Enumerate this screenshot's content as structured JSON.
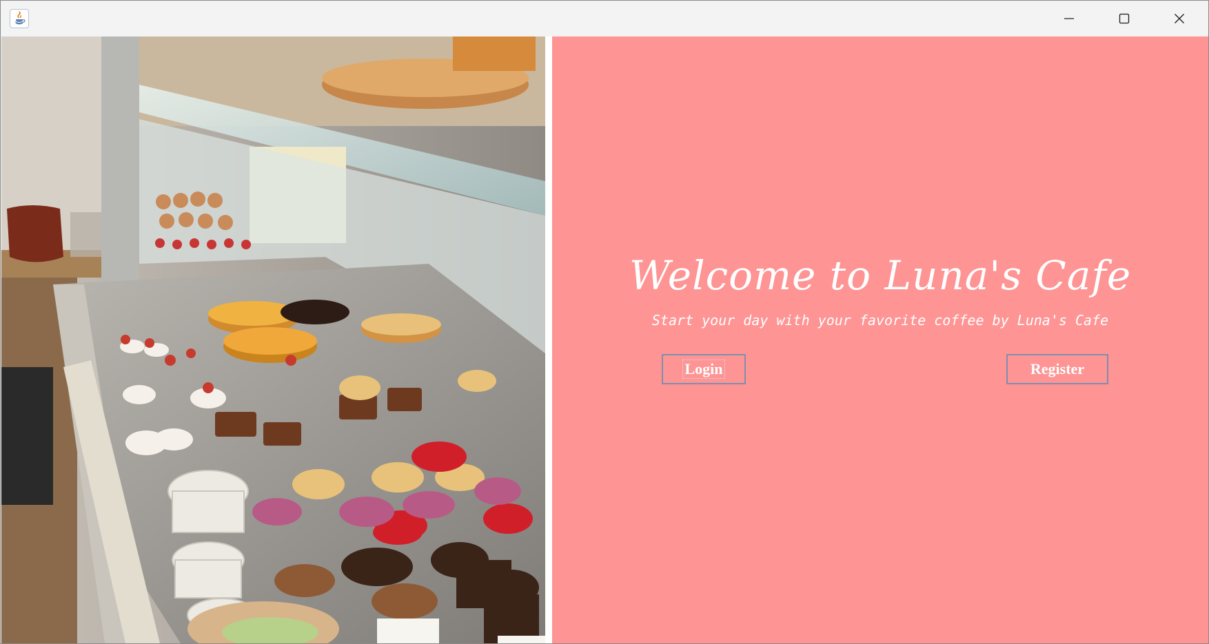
{
  "window": {
    "icon": "java-coffee-cup-icon",
    "controls": [
      "minimize-icon",
      "maximize-icon",
      "close-icon"
    ]
  },
  "photo": {
    "subject": "pastry-display-case"
  },
  "panel": {
    "background": "#fe9494",
    "welcome_text": "Welcome to Luna's Cafe",
    "tagline": "Start your day with your favorite coffee by Luna's Cafe",
    "login_label": "Login",
    "register_label": "Register"
  }
}
